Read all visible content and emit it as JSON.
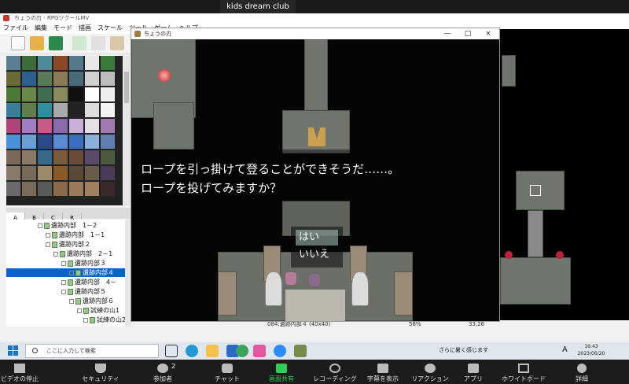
{
  "zoom_top": {
    "share_label": "kids dream club"
  },
  "editor": {
    "title": "ちょうの刃 - RPGツクールMV",
    "menu": [
      "ファイル",
      "編集",
      "モード",
      "描画",
      "スケール",
      "ツール",
      "ゲーム",
      "ヘルプ"
    ],
    "tabs": [
      "A",
      "B",
      "C",
      "R"
    ],
    "map_tree": [
      {
        "label": "遺跡内部　1－2",
        "indent": 3
      },
      {
        "label": "遺跡内部　1－1",
        "indent": 4
      },
      {
        "label": "遺跡内部２",
        "indent": 3
      },
      {
        "label": "遺跡内部　2－1",
        "indent": 4
      },
      {
        "label": "遺跡内部３",
        "indent": 5
      },
      {
        "label": "遺跡内部４",
        "indent": 6,
        "selected": true
      },
      {
        "label": "遺跡内部　4－",
        "indent": 7
      },
      {
        "label": "遺跡内部５",
        "indent": 7
      },
      {
        "label": "遺跡内部６",
        "indent": 8
      },
      {
        "label": "試練の山1",
        "indent": 9
      },
      {
        "label": "試練の山2",
        "indent": 10
      }
    ],
    "status": {
      "map": "084:遺跡内部４ (40x40)",
      "zoom": "58%",
      "coords": "33,26"
    }
  },
  "game_window": {
    "title": "ちょうの刃",
    "controls": {
      "minimize": "―",
      "maximize": "□",
      "close": "×"
    },
    "message_lines": [
      "ロープを引っ掛けて登ることができそうだ……。",
      "ロープを投げてみますか？"
    ],
    "choices": [
      "はい",
      "いいえ"
    ],
    "selected_choice_index": 0
  },
  "taskbar": {
    "search_placeholder": "ここに入力して検索",
    "weather": "さらに暑く感じます",
    "ime": "A",
    "time": "16:43",
    "date": "2023/06/20"
  },
  "zoom_bar": {
    "items": [
      "ビデオの停止",
      "セキュリティ",
      "参加者",
      "チャット",
      "画面共有",
      "レコーディング",
      "字幕を表示",
      "リアクション",
      "アプリ",
      "ホワイトボード",
      "詳細"
    ],
    "participants_count": "2"
  }
}
